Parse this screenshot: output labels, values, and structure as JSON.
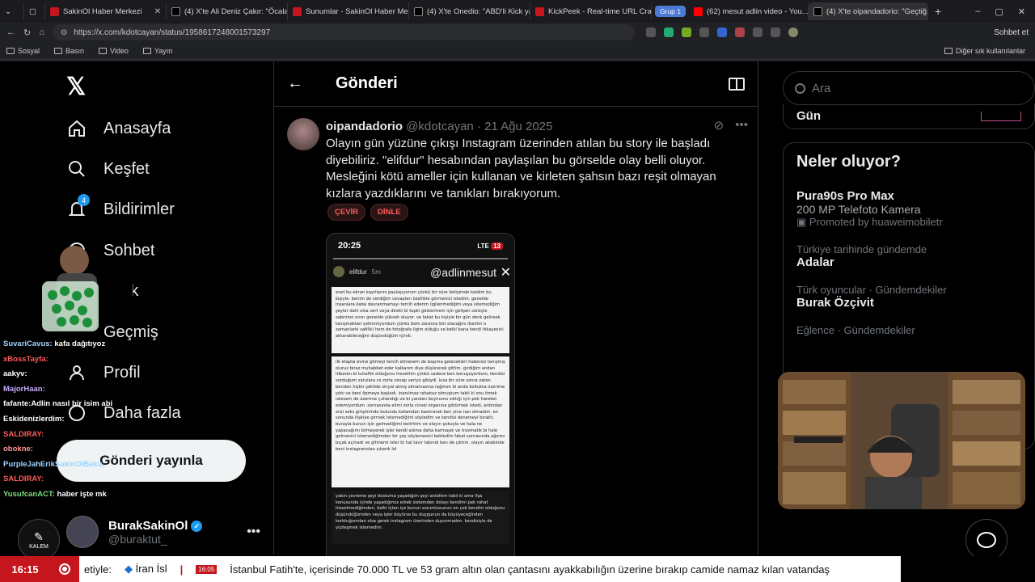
{
  "browser": {
    "tabs": [
      {
        "label": "SakinOl Haber Merkezi",
        "color": "#c4161c"
      },
      {
        "label": "(4) X'te Ali Deniz Çakır: \"Öcalan...",
        "color": "#000000"
      },
      {
        "label": "Sunumlar - SakinOl Haber Merke...",
        "color": "#c4161c"
      },
      {
        "label": "(4) X'te Onedio: \"ABD'li Kick ya...",
        "color": "#000000"
      },
      {
        "label": "KickPeek - Real-time URL Crawl...",
        "color": "#c4161c"
      },
      {
        "label": "(62) mesut adlin video - You...",
        "color": "#ff0000"
      },
      {
        "label": "(4) X'te oipandadorio: \"Geçtiğ...",
        "color": "#000000"
      }
    ],
    "group_label": "Grup 1",
    "url": "https://x.com/kdotcayan/status/1958617248001573297",
    "profile_label": "Sohbet et",
    "bookmarks": [
      "Sosyal",
      "Basın",
      "Video",
      "Yayın"
    ],
    "bookmarks_right": "Diğer sık kullanılanlar"
  },
  "nav": {
    "items": [
      "Anasayfa",
      "Keşfet",
      "Bildirimler",
      "Sohbet",
      "Grok",
      "Geçmiş",
      "Profil",
      "Daha fazla"
    ],
    "notif_count": "4",
    "post_button": "Gönderi yayınla",
    "account_name": "BurakSakinOl",
    "account_handle": "@buraktut_"
  },
  "chat": [
    {
      "user": "SuvariCavus:",
      "msg": "kafa dağıtıyoz",
      "color": "#9fd3ff"
    },
    {
      "user": "xBossTayfa:",
      "msg": "",
      "color": "#ff5a5a"
    },
    {
      "user": "",
      "msg": "aakyv:",
      "color": "#ffffff"
    },
    {
      "user": "MajorHaan:",
      "msg": "",
      "color": "#c8a8ff"
    },
    {
      "user": "fafante:",
      "msg": "Adlin nasıl bir isim abi",
      "color": "#ffffff"
    },
    {
      "user": "",
      "msg": "Eskidenizlerdim:",
      "color": "#ffffff"
    },
    {
      "user": "SALDIRAY:",
      "msg": "",
      "color": "#ff5a5a"
    },
    {
      "user": "obokne:",
      "msg": "",
      "color": "#ff9999"
    },
    {
      "user": "PurpleJahErikSakinOlBaku:",
      "msg": "",
      "color": "#9fd3ff"
    },
    {
      "user": "SALDIRAY:",
      "msg": "",
      "color": "#ff5a5a"
    },
    {
      "user": "YusufcanACT:",
      "msg": "haber işte mk",
      "color": "#7ee07e"
    }
  ],
  "kalem_label": "KALEM",
  "main": {
    "header_title": "Gönderi",
    "post": {
      "name": "oipandadorio",
      "handle": "@kdotcayan · 21 Ağu 2025",
      "text": "Olayın gün yüzüne çıkışı Instagram üzerinden atılan bu story ile başladı diyebiliriz. \"elifdur\" hesabından paylaşılan bu görselde olay belli oluyor. Mesleğini kötü ameller için kullanan ve kirleten şahsın bazı reşit olmayan kızlara yazdıklarını ve tanıkları bırakıyorum.",
      "chip_translate": "ÇEVİR",
      "chip_listen": "DİNLE"
    },
    "story": {
      "time": "20:25",
      "signal": "LTE",
      "battery": "13",
      "user": "elifdur",
      "ago": "5m",
      "watermark": "@adlinmesut",
      "para1": "evet bu ekran kayıtlarını paylaşıyorum çünkü bir süre iletişimde kaldım bu kişiyle. benim de verdiğim cevapları özellikle görmenizi istedim. genelde insanlara kaba davranmamayı tercih ederim ilgilenmediğim veya istemediğim şeyler dahi olsa sert veya direkt bi tepki göstermem için gelişen süreçte sabrımın sınırı genelde yüksek oluyor. ve fakat bu kişiyle bir gün denk gelirsek tanışmaktan çekinmiyordum çünkü bem zararsız biri olacağını (benim o zamanlarki safilik) hem de fotoğrafa ilgim olduğu ve belki bana kendi hikayesini aktarabileceğini düşündüğüm içindi.",
      "para2": "ilk etapta evine gitmeyi tercih etmesem de başıma gelecekleri habersiz tanışmış oluruz biraz muhabbet eder kalkarım diye düşünerek gittim. girdiğim andan itibaren bi tuhaflık olduğunu hissettim çünkü sadece ben konuşuyordum, kendisi sorduğum sorulara vs zorla cevap veriyo gibiydi. kısa bir süre sonra zaten benden hiçbir şekilde sinyal almış olmamasına rağmen bi anda koltukta üzerime çıktı ve beni öpmeye başladı. inanılmaz rahatsız olmuştum tabii ki onu itmek istesem de üzerime çullandığı ve bi yandan boynumu sıktığı için pek hareket edemiyordum. sonrasında elimi zorla cinsel organına götürmek istedi, ardından oral seks girişiminde bulundu kafamdan bastırarak ben yine razı olmadım. en sonunda ilişkiye girmek istemediğimi söyledim ve kendisi denemeyi bıraktı. burayla bunun için gelmediğimi belirttim ve olayın şokuyla ve hala ne yapacağımı bilmeyerek işler kendi adıma daha karmaşık ve travmatik bi hale gelmesini istemediğimden bir şey söylemesini bekledim fakat sonrasında ağzımı bıçak açmadı ve gitmemi ister bi hal tavır takındı ben de çıktım. olayın akabinde beni instagramdan çıkardı lol",
      "para3": "yakın çevreme şeyi dostuma yaşadığım şeyi anlattım tabii ki ama ifşa konusunda içinde yaşadığımız erkek sistemden dolayı kendimi pek rahat hissetmediğimden, belki içten içe bunun sorumlusunun en çok kendim olduğunu düşündüğümden veya işler büyürse bu duygunun da büyüyeceğinden korktuğumdan olsa gerek instagram üzerinden duyurmadım. kendisiyle de yüzleşmek istemedim."
    }
  },
  "right": {
    "search_placeholder": "Ara",
    "gun_label": "Gün",
    "trends_title": "Neler oluyor?",
    "trends": [
      {
        "category": "",
        "name": "Pura90s Pro Max",
        "sub": "200 MP Telefoto Kamera",
        "promo": "Promoted by huaweimobiletr"
      },
      {
        "category": "Türkiye tarihinde gündemde",
        "name": "Adalar",
        "sub": "",
        "promo": ""
      },
      {
        "category": "Türk oyuncular · Gündemdekiler",
        "name": "Burak Özçivit",
        "sub": "",
        "promo": ""
      },
      {
        "category": "Eğlence · Gündemdekiler",
        "name": "",
        "sub": "",
        "promo": ""
      }
    ]
  },
  "ticker": {
    "time": "16:15",
    "prefix": "etiyle:",
    "headline1": "İran İsl",
    "mini_time": "16:05",
    "headline2": "İstanbul Fatih'te, içerisinde 70.000 TL ve 53 gram altın olan çantasını ayakkabılığın üzerine bırakıp camide namaz kılan vatandaş"
  }
}
